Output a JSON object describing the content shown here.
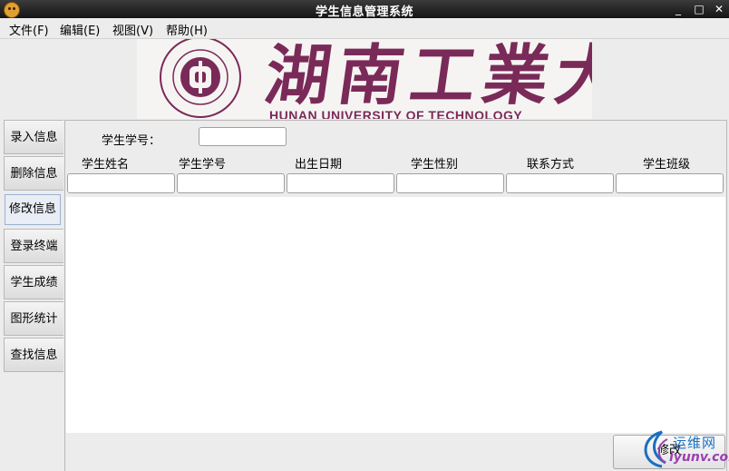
{
  "window": {
    "title": "学生信息管理系统",
    "min": "_",
    "max": "□",
    "close": "✕"
  },
  "menu": [
    "文件(F)",
    "编辑(E)",
    "视图(V)",
    "帮助(H)"
  ],
  "banner": {
    "name_cn": "湖南工業大学",
    "name_en": "HUNAN UNIVERSITY OF TECHNOLOGY",
    "color": "#7a2a58"
  },
  "tabs": [
    "录入信息",
    "删除信息",
    "修改信息",
    "登录终端",
    "学生成绩",
    "图形统计",
    "查找信息"
  ],
  "active_tab": "修改信息",
  "search": {
    "label": "学生学号：",
    "value": ""
  },
  "columns": [
    "学生姓名",
    "学生学号",
    "出生日期",
    "学生性别",
    "联系方式",
    "学生班级"
  ],
  "fields": [
    "",
    "",
    "",
    "",
    "",
    ""
  ],
  "buttons": {
    "modify": "修改"
  },
  "watermark": {
    "cn": "运维网",
    "en": "iyunv.com"
  }
}
